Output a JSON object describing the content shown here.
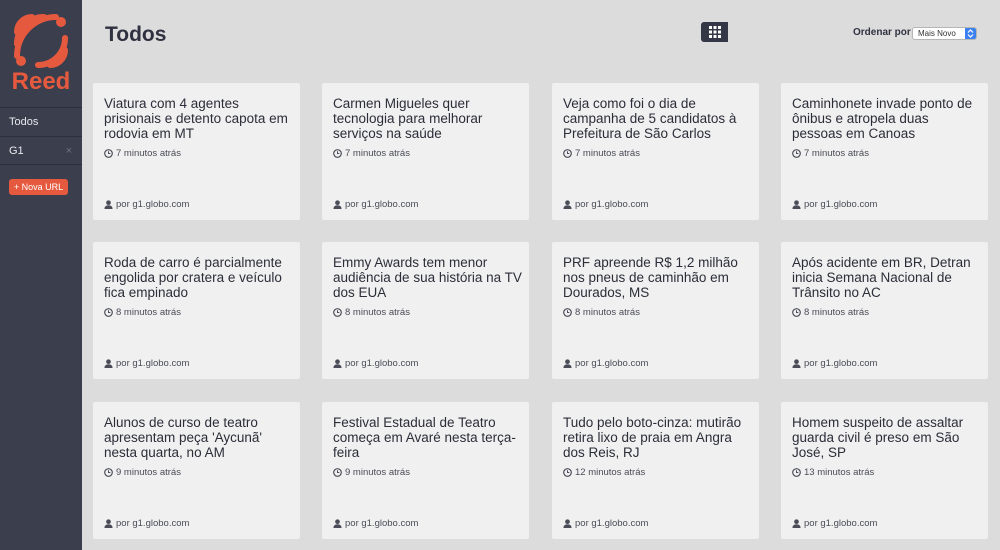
{
  "app": {
    "logo_text": "Reed"
  },
  "sidebar": {
    "items": [
      {
        "label": "Todos"
      },
      {
        "label": "G1",
        "remove": "×"
      }
    ],
    "add_button": "+ Nova URL"
  },
  "header": {
    "title": "Todos",
    "sort_label": "Ordenar por",
    "sort_value": "Mais Novo"
  },
  "colors": {
    "accent": "#e55a3f",
    "sidebar": "#3b3e4d",
    "card": "#f0f0f0",
    "background": "#dcdcdc"
  },
  "cards": [
    {
      "title": "Viatura com 4 agentes prisionais e detento capota em rodovia em MT",
      "time": "7 minutos atrás",
      "source": "por g1.globo.com"
    },
    {
      "title": "Carmen Migueles quer tecnologia para melhorar serviços na saúde",
      "time": "7 minutos atrás",
      "source": "por g1.globo.com"
    },
    {
      "title": "Veja como foi o dia de campanha de 5 candidatos à Prefeitura de São Carlos",
      "time": "7 minutos atrás",
      "source": "por g1.globo.com"
    },
    {
      "title": "Caminhonete invade ponto de ônibus e atropela duas pessoas em Canoas",
      "time": "7 minutos atrás",
      "source": "por g1.globo.com"
    },
    {
      "title": "Roda de carro é parcialmente engolida por cratera e veículo fica empinado",
      "time": "8 minutos atrás",
      "source": "por g1.globo.com"
    },
    {
      "title": "Emmy Awards tem menor audiência de sua história na TV dos EUA",
      "time": "8 minutos atrás",
      "source": "por g1.globo.com"
    },
    {
      "title": "PRF apreende R$ 1,2 milhão nos pneus de caminhão em Dourados, MS",
      "time": "8 minutos atrás",
      "source": "por g1.globo.com"
    },
    {
      "title": "Após acidente em BR, Detran inicia Semana Nacional de Trânsito no AC",
      "time": "8 minutos atrás",
      "source": "por g1.globo.com"
    },
    {
      "title": "Alunos de curso de teatro apresentam peça 'Aycunã' nesta quarta, no AM",
      "time": "9 minutos atrás",
      "source": "por g1.globo.com"
    },
    {
      "title": "Festival Estadual de Teatro começa em Avaré nesta terça-feira",
      "time": "9 minutos atrás",
      "source": "por g1.globo.com"
    },
    {
      "title": "Tudo pelo boto-cinza: mutirão retira lixo de praia em Angra dos Reis, RJ",
      "time": "12 minutos atrás",
      "source": "por g1.globo.com"
    },
    {
      "title": "Homem suspeito de assaltar guarda civil é preso em São José, SP",
      "time": "13 minutos atrás",
      "source": "por g1.globo.com"
    }
  ]
}
